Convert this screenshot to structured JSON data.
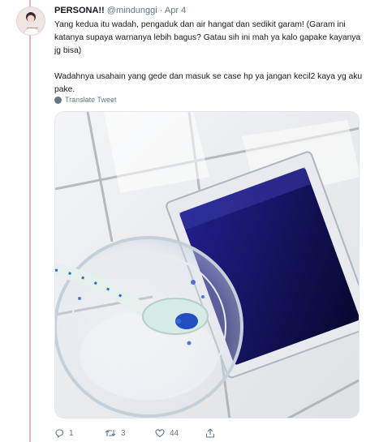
{
  "tweet": {
    "display_name": "PERSONA!!",
    "handle": "@mindunggi",
    "separator": "·",
    "date": "Apr 4",
    "text_paragraph_1": "Yang kedua itu wadah, pengaduk dan air hangat dan sedikit garam! (Garam ini katanya supaya warnanya lebih bagus? Gatau sih ini mah ya kalo gapake kayanya jg bisa)",
    "text_paragraph_2": "Wadahnya usahain yang gede dan masuk se case hp ya jangan kecil2 kaya yg aku pake.",
    "translate_label": "Translate Tweet"
  },
  "actions": {
    "reply_count": "1",
    "retweet_count": "3",
    "like_count": "44"
  },
  "icons": {
    "reply": "reply-icon",
    "retweet": "retweet-icon",
    "like": "heart-icon",
    "share": "share-icon",
    "translate": "globe-icon"
  },
  "colors": {
    "thread_line": "#e6b3c1",
    "secondary_text": "#657786",
    "dye_blue": "#1a1a8c"
  }
}
